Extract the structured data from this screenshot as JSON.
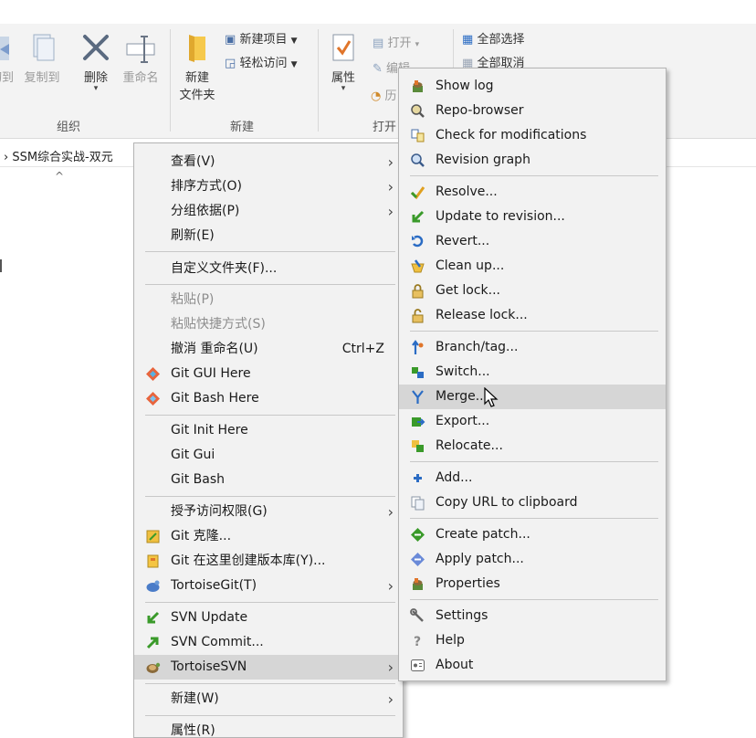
{
  "ribbon": {
    "cut_label": "切到",
    "copy_to_label": "复制到",
    "delete_label": "删除",
    "rename_label": "重命名",
    "new_folder_label_1": "新建",
    "new_folder_label_2": "文件夹",
    "new_item_label": "新建项目",
    "easy_access_label": "轻松访问",
    "properties_label": "属性",
    "open_label": "打开",
    "edit_label": "编辑",
    "history_label": "历",
    "select_all_label": "全部选择",
    "select_none_label": "全部取消",
    "group_organize": "组织",
    "group_new": "新建",
    "group_open": "打开"
  },
  "address": {
    "path": "› SSM综合实战-双元"
  },
  "context_menu": {
    "items": [
      {
        "label": "查看(V)",
        "submenu": true
      },
      {
        "label": "排序方式(O)",
        "submenu": true
      },
      {
        "label": "分组依据(P)",
        "submenu": true
      },
      {
        "label": "刷新(E)"
      },
      {
        "label": "自定义文件夹(F)..."
      },
      {
        "label": "粘贴(P)",
        "disabled": true
      },
      {
        "label": "粘贴快捷方式(S)",
        "disabled": true
      },
      {
        "label": "撤消 重命名(U)",
        "shortcut": "Ctrl+Z"
      },
      {
        "label": "Git GUI Here",
        "icon": "git-gui-icon"
      },
      {
        "label": "Git Bash Here",
        "icon": "git-bash-icon"
      },
      {
        "label": "Git Init Here"
      },
      {
        "label": "Git Gui"
      },
      {
        "label": "Git Bash"
      },
      {
        "label": "授予访问权限(G)",
        "submenu": true
      },
      {
        "label": "Git 克隆...",
        "icon": "git-clone-icon"
      },
      {
        "label": "Git 在这里创建版本库(Y)...",
        "icon": "git-create-repo-icon"
      },
      {
        "label": "TortoiseGit(T)",
        "submenu": true,
        "icon": "tortoisegit-icon"
      },
      {
        "label": "SVN Update",
        "icon": "svn-update-icon"
      },
      {
        "label": "SVN Commit...",
        "icon": "svn-commit-icon"
      },
      {
        "label": "TortoiseSVN",
        "submenu": true,
        "icon": "tortoisesvn-icon",
        "highlighted": true
      },
      {
        "label": "新建(W)",
        "submenu": true
      },
      {
        "label": "属性(R)"
      }
    ]
  },
  "svn_submenu": {
    "items": [
      {
        "label": "Show log",
        "icon": "show-log-icon"
      },
      {
        "label": "Repo-browser",
        "icon": "repo-browser-icon"
      },
      {
        "label": "Check for modifications",
        "icon": "check-modifications-icon"
      },
      {
        "label": "Revision graph",
        "icon": "revision-graph-icon"
      },
      {
        "label": "Resolve...",
        "icon": "resolve-icon"
      },
      {
        "label": "Update to revision...",
        "icon": "update-revision-icon"
      },
      {
        "label": "Revert...",
        "icon": "revert-icon"
      },
      {
        "label": "Clean up...",
        "icon": "cleanup-icon"
      },
      {
        "label": "Get lock...",
        "icon": "lock-icon"
      },
      {
        "label": "Release lock...",
        "icon": "unlock-icon"
      },
      {
        "label": "Branch/tag...",
        "icon": "branch-icon"
      },
      {
        "label": "Switch...",
        "icon": "switch-icon"
      },
      {
        "label": "Merge...",
        "icon": "merge-icon",
        "highlighted": true
      },
      {
        "label": "Export...",
        "icon": "export-icon"
      },
      {
        "label": "Relocate...",
        "icon": "relocate-icon"
      },
      {
        "label": "Add...",
        "icon": "add-icon"
      },
      {
        "label": "Copy URL to clipboard",
        "icon": "copy-url-icon"
      },
      {
        "label": "Create patch...",
        "icon": "create-patch-icon"
      },
      {
        "label": "Apply patch...",
        "icon": "apply-patch-icon"
      },
      {
        "label": "Properties",
        "icon": "properties-icon"
      },
      {
        "label": "Settings",
        "icon": "settings-icon"
      },
      {
        "label": "Help",
        "icon": "help-icon"
      },
      {
        "label": "About",
        "icon": "about-icon"
      }
    ]
  },
  "colors": {
    "menu_bg": "#f2f2f2",
    "highlight": "#d6d6d6",
    "ribbon_bg": "#f3f3f3",
    "accent_blue": "#2b6cc4",
    "svn_green": "#3a9a2a"
  }
}
